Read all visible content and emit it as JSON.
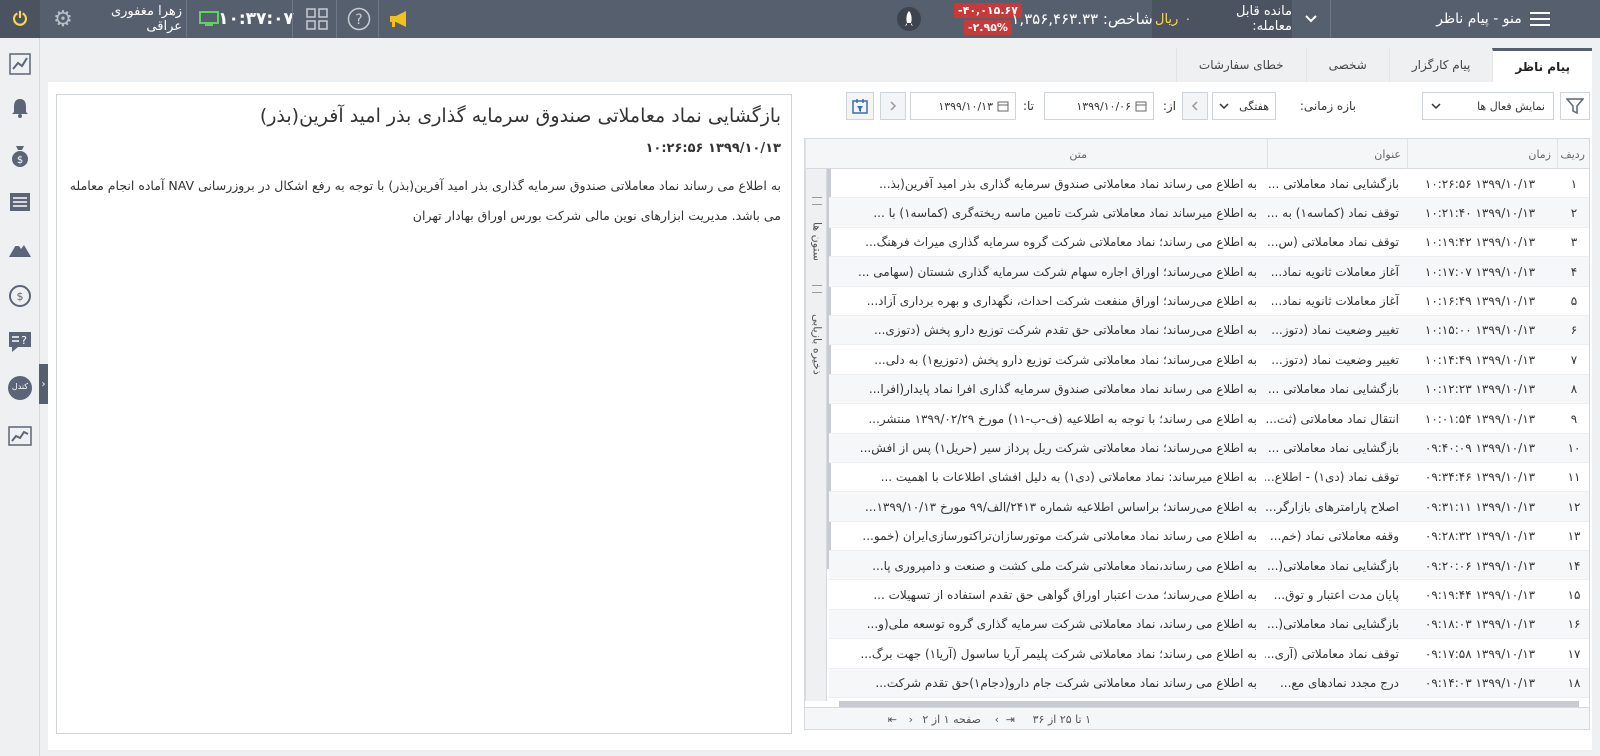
{
  "topbar": {
    "menu_title": "منو - پیام ناظر",
    "balance_label": "مانده قابل معامله:",
    "balance_value": "۰",
    "balance_unit": "ریال",
    "index_label": "شاخص:",
    "index_value": "۱,۳۵۶,۴۶۳.۳۳",
    "index_change": "-۴۰,۰۱۵.۶۷",
    "index_change_pct": "-۲.۹۵%",
    "clock": "۱۰:۳۷:۰۷",
    "username": "زهرا مغفوری عراقی"
  },
  "tabs": [
    {
      "label": "پیام ناظر",
      "active": true
    },
    {
      "label": "پیام کارگزار",
      "active": false
    },
    {
      "label": "شخصی",
      "active": false
    },
    {
      "label": "خطای سفارشات",
      "active": false
    }
  ],
  "filters": {
    "active_select": "نمایش فعال ها",
    "range_label": "بازه زمانی:",
    "period": "هفتگی",
    "from_label": "از:",
    "date_from": "۱۳۹۹/۱۰/۰۶",
    "to_label": "تا:",
    "date_to": "۱۳۹۹/۱۰/۱۳"
  },
  "grid": {
    "headers": {
      "rank": "ردیف",
      "time": "زمان",
      "title": "عنوان",
      "text": "متن"
    },
    "side_tabs": [
      "ستون ها",
      "ذخیره بازیابی"
    ],
    "rows": [
      {
        "rank": "۱",
        "time": "۱۳۹۹/۱۰/۱۳ ۱۰:۲۶:۵۶",
        "title": "بازگشایی نماد معاملاتی ...",
        "text": "به اطلاع می رساند نماد معاملاتی صندوق سرمایه گذاری بذر امید آفرین(بذ..."
      },
      {
        "rank": "۲",
        "time": "۱۳۹۹/۱۰/۱۳ ۱۰:۲۱:۴۰",
        "title": "توقف نماد (کماسه۱) به ...",
        "text": "به اطلاع میرساند نماد معاملاتی شرکت تامین ماسه ریخته‌گری (کماسه۱) با ..."
      },
      {
        "rank": "۳",
        "time": "۱۳۹۹/۱۰/۱۳ ۱۰:۱۹:۴۲",
        "title": "توقف نماد معاملاتی (س...",
        "text": "به اطلاع می رساند؛ نماد معاملاتی شرکت گروه سرمایه گذاری میراث فرهنگ..."
      },
      {
        "rank": "۴",
        "time": "۱۳۹۹/۱۰/۱۳ ۱۰:۱۷:۰۷",
        "title": "آغاز معاملات ثانویه نماد...",
        "text": "به اطلاع می‌رساند؛ اوراق اجاره سهام شرکت سرمایه گذاری شستان (سهامی ..."
      },
      {
        "rank": "۵",
        "time": "۱۳۹۹/۱۰/۱۳ ۱۰:۱۶:۴۹",
        "title": "آغاز معاملات ثانویه نماد...",
        "text": "به اطلاع می‌رساند؛ اوراق منفعت شرکت احداث، نگهداری و بهره برداری آزاد..."
      },
      {
        "rank": "۶",
        "time": "۱۳۹۹/۱۰/۱۳ ۱۰:۱۵:۰۰",
        "title": "تغییر وضعیت نماد (دتوز...",
        "text": "به اطلاع می‌رساند؛ نماد معاملاتی حق تقدم شرکت توزیع دارو پخش (دتوزی..."
      },
      {
        "rank": "۷",
        "time": "۱۳۹۹/۱۰/۱۳ ۱۰:۱۴:۴۹",
        "title": "تغییر وضعیت نماد (دتوز...",
        "text": "به اطلاع می‌رساند؛ نماد معاملاتی شرکت توزیع دارو پخش (دتوزیع۱) به دلی..."
      },
      {
        "rank": "۸",
        "time": "۱۳۹۹/۱۰/۱۳ ۱۰:۱۲:۲۳",
        "title": "بازگشایی نماد معاملاتی ...",
        "text": "به اطلاع می رساند نماد معاملاتی صندوق سرمایه گذاری افرا نماد پایدار(افرا..."
      },
      {
        "rank": "۹",
        "time": "۱۳۹۹/۱۰/۱۳ ۱۰:۰۱:۵۴",
        "title": "انتقال نماد معاملاتی (ثت...",
        "text": "به اطلاع می رساند؛ با توجه به اطلاعیه (ف-ب-۱۱) مورخ ۱۳۹۹/۰۲/۲۹ منتشر..."
      },
      {
        "rank": "۱۰",
        "time": "۱۳۹۹/۱۰/۱۳ ۰۹:۴۰:۰۹",
        "title": "بازگشایی نماد معاملاتی ...",
        "text": "به اطلاع می‌رساند؛ نماد معاملاتی شرکت ریل پرداز سیر (حریل۱) پس از افش..."
      },
      {
        "rank": "۱۱",
        "time": "۱۳۹۹/۱۰/۱۳ ۰۹:۳۴:۴۶",
        "title": "توقف نماد (دی۱) - اطلاع...",
        "text": "به اطلاع میرساند: نماد معاملاتی (دی۱) به دلیل افشای اطلاعات با اهمیت ..."
      },
      {
        "rank": "۱۲",
        "time": "۱۳۹۹/۱۰/۱۳ ۰۹:۳۱:۱۱",
        "title": "اصلاح پارامترهای بازارگر...",
        "text": "به اطلاع می‌رساند؛ براساس اطلاعیه شماره ۲۴۱۳/الف/۹۹ مورخ ۱۳۹۹/۱۰/۱۳..."
      },
      {
        "rank": "۱۳",
        "time": "۱۳۹۹/۱۰/۱۳ ۰۹:۲۸:۳۲",
        "title": "وقفه معاملاتی نماد (خم...",
        "text": "به اطلاع می رساند نماد معاملاتی شرکت موتورسازان‌تراکتورسازی‌ایران (خمو..."
      },
      {
        "rank": "۱۴",
        "time": "۱۳۹۹/۱۰/۱۳ ۰۹:۲۰:۰۶",
        "title": "بازگشایی نماد معاملاتی(...",
        "text": "به اطلاع می رساند،نماد معاملاتی شرکت ملی کشت و صنعت و دامپروری پا..."
      },
      {
        "rank": "۱۵",
        "time": "۱۳۹۹/۱۰/۱۳ ۰۹:۱۹:۴۴",
        "title": "پایان مدت اعتبار و توق...",
        "text": "به اطلاع می‌رساند؛ مدت اعتبار اوراق گواهی حق تقدم استفاده از تسهیلات ..."
      },
      {
        "rank": "۱۶",
        "time": "۱۳۹۹/۱۰/۱۳ ۰۹:۱۸:۰۳",
        "title": "بازگشایی نماد معاملاتی(...",
        "text": "به اطلاع می رساند، نماد معاملاتی شرکت سرمایه گذاری گروه توسعه ملی(و..."
      },
      {
        "rank": "۱۷",
        "time": "۱۳۹۹/۱۰/۱۳ ۰۹:۱۷:۵۸",
        "title": "توقف نماد معاملاتی (آری...",
        "text": "به اطلاع می رساند؛ نماد معاملاتی شرکت پلیمر آریا ساسول (آریا۱) جهت برگ..."
      },
      {
        "rank": "۱۸",
        "time": "۱۳۹۹/۱۰/۱۳ ۰۹:۱۴:۰۳",
        "title": "درج مجدد نمادهای مع...",
        "text": "به اطلاع می رساند نماد معاملاتی شرکت جام دارو(دجام۱)حق تقدم شرکت..."
      }
    ],
    "pager": {
      "range": "۱ تا ۲۵ از ۳۶",
      "page_label": "صفحه ۱ از ۲"
    }
  },
  "detail": {
    "title": "بازگشایی نماد معاملاتی صندوق سرمایه گذاری بذر امید آفرین(بذر)",
    "time": "۱۳۹۹/۱۰/۱۳ ۱۰:۲۶:۵۶",
    "body": "به اطلاع می رساند نماد معاملاتی صندوق سرمایه گذاری بذر امید آفرین(بذر) با توجه به رفع اشکال در بروزرسانی NAV آماده انجام معامله می باشد. مدیریت ابزارهای نوین مالی شرکت بورس اوراق بهادار تهران"
  },
  "sidebar": {
    "candle_label": "کندل"
  },
  "colors": {
    "topbar": "#565f6e",
    "accent_yellow": "#ffd84a",
    "negative": "#c83a3a"
  }
}
